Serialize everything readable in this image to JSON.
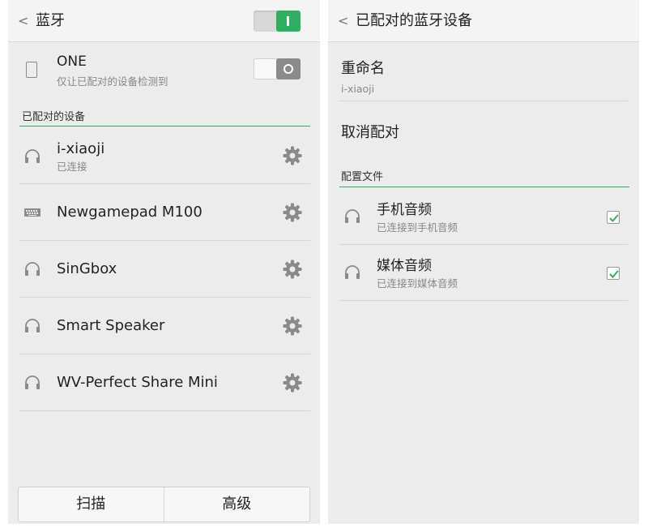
{
  "left": {
    "header": {
      "back_icon": "chevron-left-icon",
      "title": "蓝牙",
      "bluetooth_toggle": "on"
    },
    "visibility": {
      "name": "ONE",
      "subtitle": "仅让已配对的设备检测到",
      "toggle": "off"
    },
    "paired_section_label": "已配对的设备",
    "devices": [
      {
        "name": "i-xiaoji",
        "status": "已连接",
        "icon": "headset-icon"
      },
      {
        "name": "Newgamepad M100",
        "status": "",
        "icon": "keyboard-icon"
      },
      {
        "name": "SinGbox",
        "status": "",
        "icon": "headset-icon"
      },
      {
        "name": "Smart Speaker",
        "status": "",
        "icon": "headset-icon"
      },
      {
        "name": "WV-Perfect Share Mini",
        "status": "",
        "icon": "headset-icon"
      }
    ],
    "bottom": {
      "scan_label": "扫描",
      "advanced_label": "高级"
    }
  },
  "right": {
    "header": {
      "back_icon": "chevron-left-icon",
      "title": "已配对的蓝牙设备"
    },
    "rename": {
      "label": "重命名",
      "value": "i-xiaoji"
    },
    "unpair_label": "取消配对",
    "profiles_section_label": "配置文件",
    "profiles": [
      {
        "name": "手机音频",
        "status": "已连接到手机音频",
        "checked": true
      },
      {
        "name": "媒体音频",
        "status": "已连接到媒体音频",
        "checked": true
      }
    ]
  },
  "colors": {
    "accent": "#2fb060",
    "panel_bg": "#ececec",
    "header_bg": "#f4f4f4"
  }
}
